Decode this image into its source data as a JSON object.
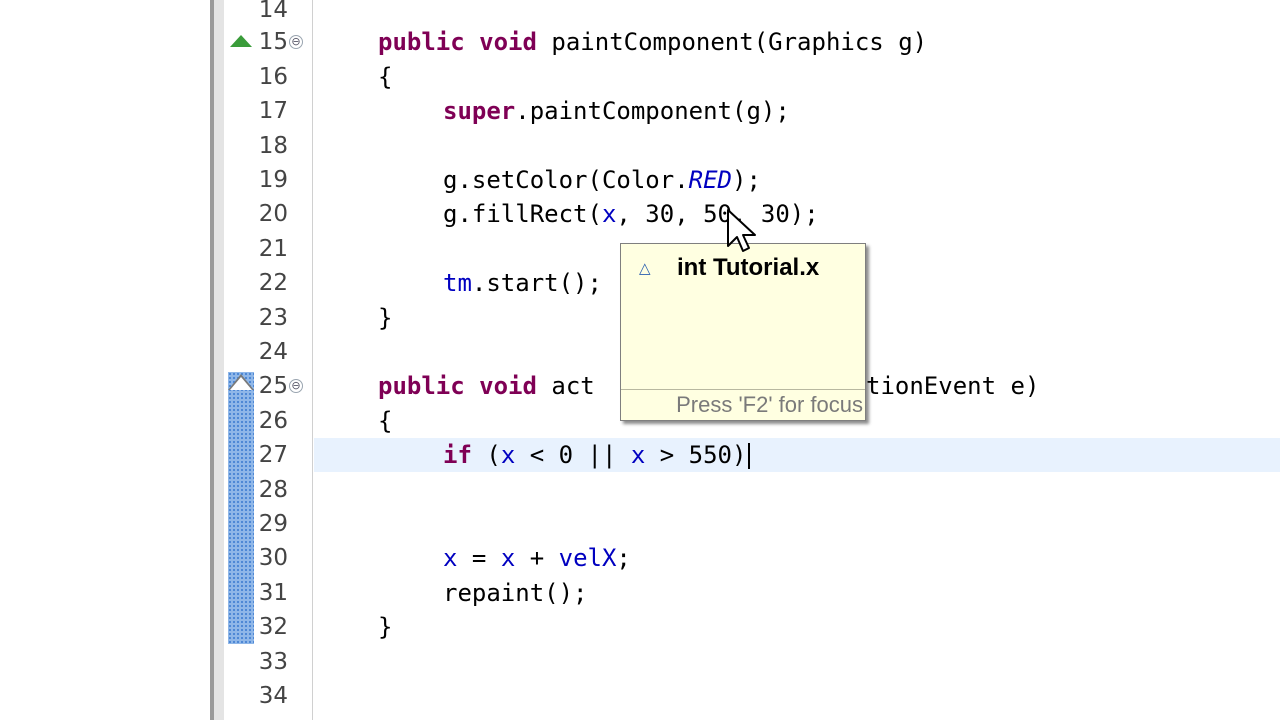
{
  "line_numbers": [
    "14",
    "15",
    "16",
    "17",
    "18",
    "19",
    "20",
    "21",
    "22",
    "23",
    "24",
    "25",
    "26",
    "27",
    "28",
    "29",
    "30",
    "31",
    "32",
    "33",
    "34"
  ],
  "code": {
    "l15": {
      "kw1": "public",
      "kw2": "void",
      "rest": "paintComponent(Graphics g)"
    },
    "l16": {
      "text": "{"
    },
    "l17": {
      "kw": "super",
      "rest": ".paintComponent(g);"
    },
    "l19": {
      "pre": "g.setColor(Color.",
      "sfld": "RED",
      "post": ");"
    },
    "l20": {
      "pre": "g.fillRect(",
      "fld": "x",
      "post": ", 30, 50, 30);"
    },
    "l22": {
      "fld": "tm",
      "post": ".start();"
    },
    "l23": {
      "text": "}"
    },
    "l25": {
      "kw1": "public",
      "kw2": "void",
      "pre": "act",
      "post": "tionEvent e)"
    },
    "l26": {
      "text": "{"
    },
    "l27": {
      "kw": "if",
      "a": " (",
      "x1": "x",
      "b": " < 0 || ",
      "x2": "x",
      "c": " > 550)"
    },
    "l30": {
      "x1": "x",
      "a": " = ",
      "x2": "x",
      "b": " + ",
      "v": "velX",
      "c": ";"
    },
    "l31": {
      "text": "repaint();"
    },
    "l32": {
      "text": "}"
    }
  },
  "hover": {
    "icon": "field-triangle-icon",
    "title": "int Tutorial.x",
    "footer": "Press 'F2' for focus"
  },
  "fold_glyph": "⊖",
  "colors": {
    "keyword": "#7f0055",
    "field": "#0000c0",
    "current_line": "#e8f2fe",
    "hover_bg": "#ffffe1"
  }
}
